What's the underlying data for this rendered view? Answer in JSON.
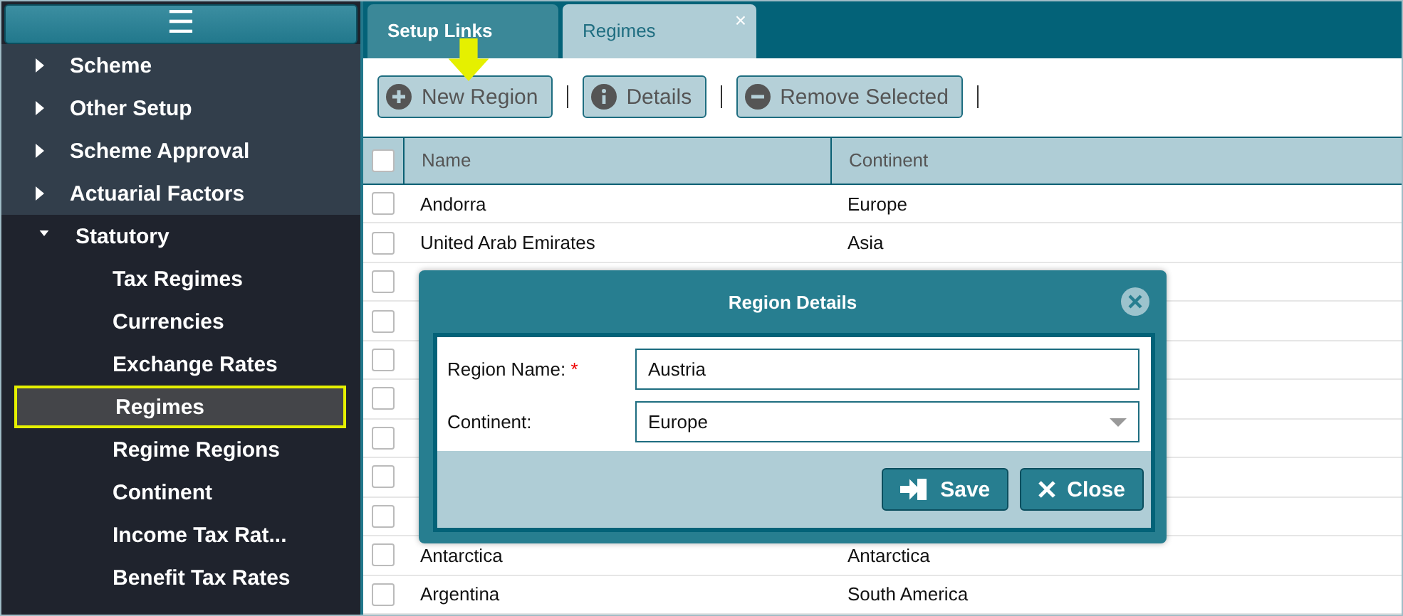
{
  "sidebar": {
    "menu_icon": "☰",
    "items": [
      {
        "label": "Scheme",
        "expanded": false
      },
      {
        "label": "Other Setup",
        "expanded": false
      },
      {
        "label": "Scheme Approval",
        "expanded": false
      },
      {
        "label": "Actuarial Factors",
        "expanded": false
      },
      {
        "label": "Statutory",
        "expanded": true,
        "children": [
          {
            "label": "Tax Regimes",
            "selected": false
          },
          {
            "label": "Currencies",
            "selected": false
          },
          {
            "label": "Exchange Rates",
            "selected": false
          },
          {
            "label": "Regimes",
            "selected": true
          },
          {
            "label": "Regime Regions",
            "selected": false
          },
          {
            "label": "Continent",
            "selected": false
          },
          {
            "label": "Income Tax Rat...",
            "selected": false
          },
          {
            "label": "Benefit Tax Rates",
            "selected": false
          }
        ]
      }
    ]
  },
  "tabs": [
    {
      "label": "Setup Links",
      "selected": false
    },
    {
      "label": "Regimes",
      "selected": true,
      "close_icon": "×"
    }
  ],
  "toolbar": [
    {
      "label": "New Region",
      "kind": "add"
    },
    {
      "label": "Details",
      "kind": "info"
    },
    {
      "label": "Remove Selected",
      "kind": "remove"
    }
  ],
  "table": {
    "all_checked": false,
    "columns": [
      "Name",
      "Continent"
    ],
    "rows": [
      {
        "name": "Andorra",
        "continent": "Europe",
        "checked": false
      },
      {
        "name": "United Arab Emirates",
        "continent": "Asia",
        "checked": false
      },
      {
        "checked": false
      },
      {
        "checked": false
      },
      {
        "checked": false
      },
      {
        "checked": false
      },
      {
        "checked": false
      },
      {
        "checked": false
      },
      {
        "checked": false
      },
      {
        "name": "Antarctica",
        "continent": "Antarctica",
        "checked": false
      },
      {
        "name": "Argentina",
        "continent": "South America",
        "checked": false
      }
    ]
  },
  "dialog": {
    "title": "Region Details",
    "fields": [
      {
        "label": "Region Name:",
        "required": true,
        "value": "Austria",
        "kind": "text"
      },
      {
        "label": "Continent:",
        "required": false,
        "value": "Europe",
        "kind": "select"
      }
    ],
    "required_mark": "*",
    "buttons": [
      {
        "label": "Save",
        "kind": "save"
      },
      {
        "label": "Close",
        "kind": "close"
      }
    ]
  }
}
